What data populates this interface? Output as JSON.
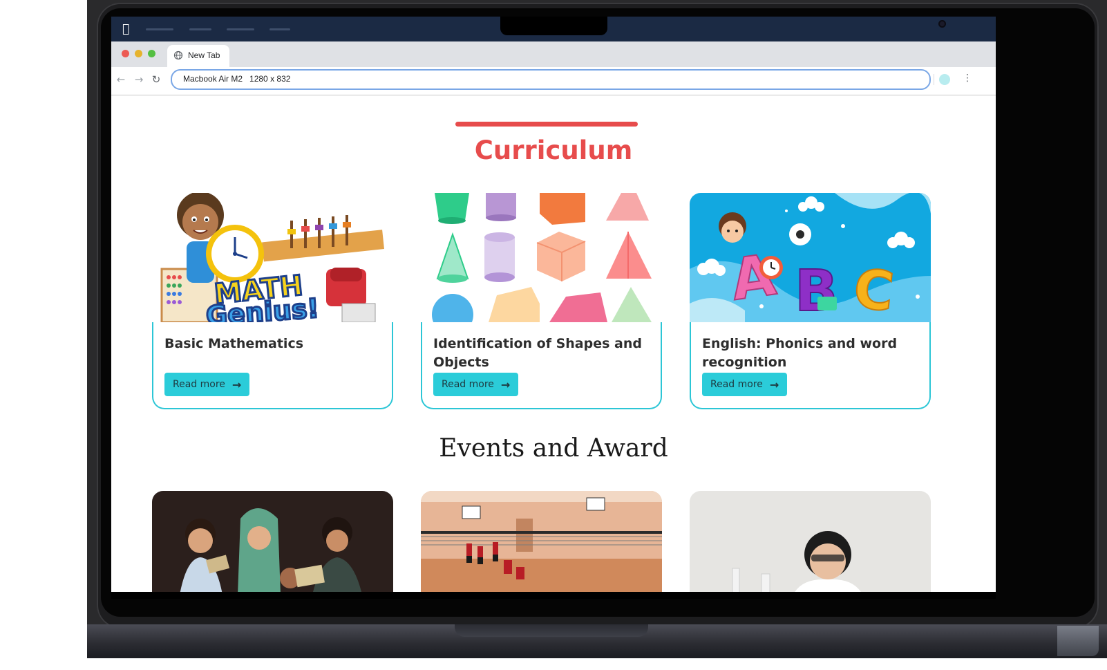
{
  "browser": {
    "tab_title": "New Tab",
    "address_value": "Macbook Air M2   1280 x 832"
  },
  "page": {
    "section_title": "Curriculum",
    "events_title": "Events and Award",
    "cards": [
      {
        "title": "Basic Mathematics",
        "button": "Read more"
      },
      {
        "title": "Identification of Shapes and Objects",
        "button": "Read more"
      },
      {
        "title": "English: Phonics and word recognition",
        "button": "Read more"
      }
    ]
  },
  "colors": {
    "accent_red": "#e74c4c",
    "accent_cyan": "#2bccd9",
    "menubar": "#1b2a44"
  },
  "icons": {
    "apple": "apple-logo-icon",
    "globe": "globe-icon",
    "back": "back-arrow-icon",
    "forward": "forward-arrow-icon",
    "reload": "reload-icon",
    "menu": "kebab-menu-icon",
    "read_more": "arrow-right-icon"
  }
}
